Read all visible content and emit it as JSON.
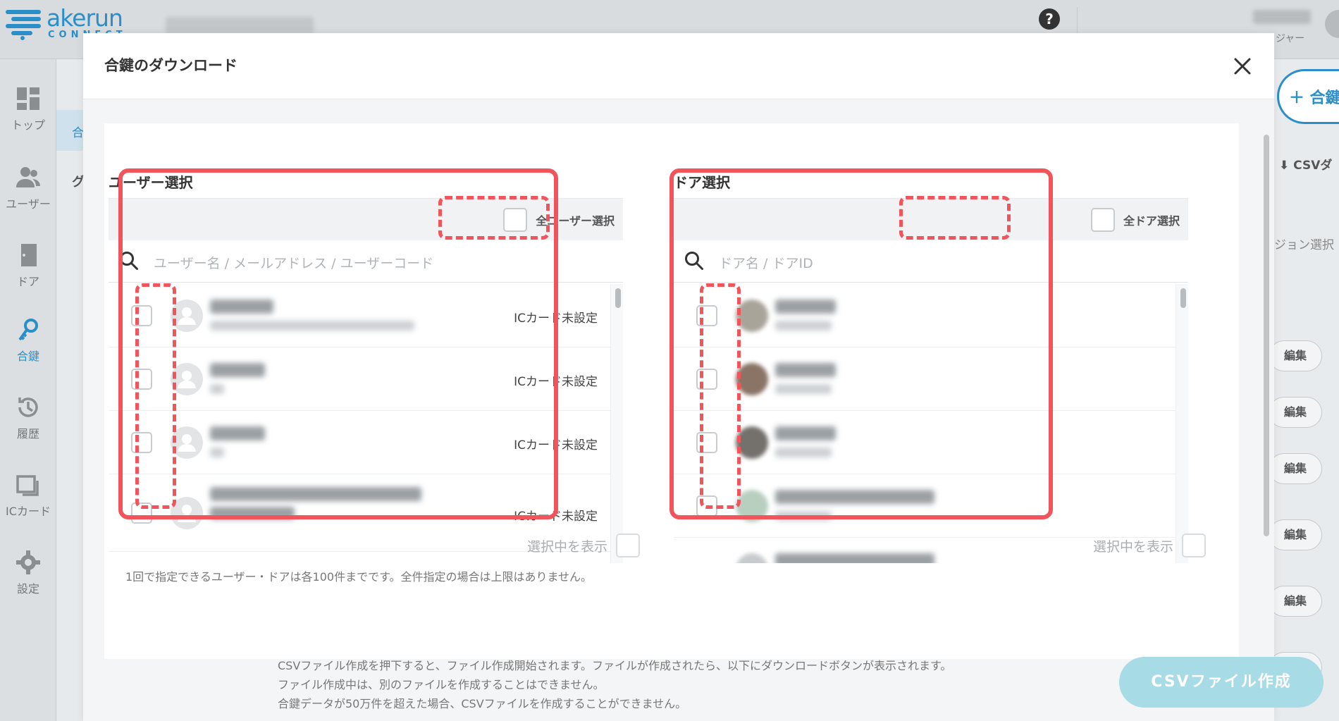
{
  "app": {
    "logo_text": "akerun",
    "logo_sub": "CONNECT",
    "user_role": "ジャー"
  },
  "sidebar": {
    "items": [
      {
        "label": "トップ",
        "icon": "dashboard-icon"
      },
      {
        "label": "ユーザー",
        "icon": "users-icon"
      },
      {
        "label": "ドア",
        "icon": "door-icon"
      },
      {
        "label": "合鍵",
        "icon": "key-icon"
      },
      {
        "label": "履歴",
        "icon": "history-icon"
      },
      {
        "label": "ICカード",
        "icon": "ic-card-icon"
      },
      {
        "label": "設定",
        "icon": "gear-icon"
      }
    ],
    "active": "合鍵"
  },
  "subnav": {
    "selected": "合",
    "item2": "グ"
  },
  "right": {
    "add_label": "＋ 合鍵",
    "csv_label": "⬇ CSVダ",
    "version_select": "ジョン選択",
    "edit_label": "編集"
  },
  "modal": {
    "title": "合鍵のダウンロード",
    "user_panel": {
      "title": "ユーザー選択",
      "select_all": "全ユーザー選択",
      "search_placeholder": "ユーザー名 / メールアドレス / ユーザーコード",
      "rows": [
        {
          "status": "ICカード未設定"
        },
        {
          "status": "ICカード未設定"
        },
        {
          "status": "ICカード未設定"
        },
        {
          "status": "ICカード未設定"
        }
      ],
      "show_selected": "選択中を表示"
    },
    "door_panel": {
      "title": "ドア選択",
      "select_all": "全ドア選択",
      "search_placeholder": "ドア名 / ドアID",
      "show_selected": "選択中を表示"
    },
    "limit_note": "1回で指定できるユーザー・ドアは各100件までです。全件指定の場合は上限はありません。",
    "info_lines": [
      "CSVファイル作成を押下すると、ファイル作成開始されます。ファイルが作成されたら、以下にダウンロードボタンが表示されます。",
      "ファイル作成中は、別のファイルを作成することはできません。",
      "合鍵データが50万件を超えた場合、CSVファイルを作成することができません。"
    ],
    "create_button": "CSVファイル作成"
  },
  "colors": {
    "accent": "#2a8fc9",
    "highlight": "#f2545b",
    "button_disabled": "#a7dbe6"
  }
}
